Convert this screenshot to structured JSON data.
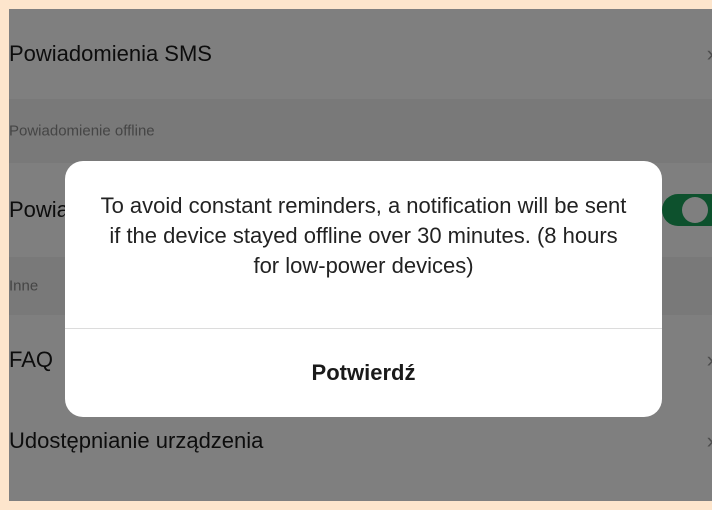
{
  "settings": {
    "sms_row": {
      "label": "Powiadomienia SMS",
      "chevron": "›"
    },
    "offline_section": {
      "label": "Powiadomienie offline"
    },
    "offline_row": {
      "label": "Powiadomienie offline"
    },
    "other_section": {
      "label": "Inne"
    },
    "faq_row": {
      "label": "FAQ",
      "chevron": "›"
    },
    "sharing_row": {
      "label": "Udostępnianie urządzenia",
      "chevron": "›"
    }
  },
  "toggle": {
    "on": true,
    "color": "#1aa35a"
  },
  "dialog": {
    "message": "To avoid constant reminders, a notification will be sent if the device stayed offline over 30 minutes. (8 hours for low-power devices)",
    "confirm_label": "Potwierdź"
  },
  "icons": {
    "chevron": "chevron-right-icon"
  }
}
